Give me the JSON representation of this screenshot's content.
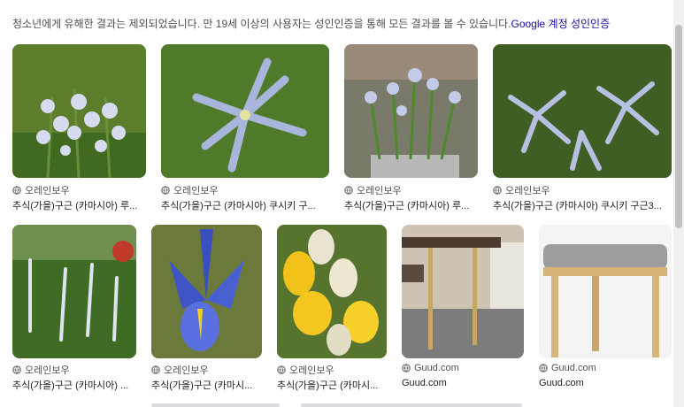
{
  "notice": {
    "text": "청소년에게 유해한 결과는 제외되었습니다. 만 19세 이상의 사용자는 성인인증을 통해 모든 결과를 볼 수 있습니다.",
    "link": "Google 계정 성인인증"
  },
  "results": [
    {
      "source": "오레인보우",
      "title": "추식(가을)구근 (카마시아) 루..."
    },
    {
      "source": "오레인보우",
      "title": "추식(가을)구근 (카마시아) 쿠시키 구..."
    },
    {
      "source": "오레인보우",
      "title": "추식(가을)구근 (카마시아) 루..."
    },
    {
      "source": "오레인보우",
      "title": "추식(가을)구근 (카마시아) 쿠시키 구근3..."
    },
    {
      "source": "오레인보우",
      "title": "추식(가을)구근 (카마시아) ..."
    },
    {
      "source": "오레인보우",
      "title": "추식(가을)구근 (카마시..."
    },
    {
      "source": "오레인보우",
      "title": "추식(가을)구근 (카마시..."
    },
    {
      "source": "Guud.com",
      "title": "Guud.com"
    },
    {
      "source": "Guud.com",
      "title": "Guud.com"
    }
  ],
  "icons": {
    "source": "globe-icon"
  },
  "colors": {
    "link": "#1a0dab",
    "meta": "#4d5156"
  }
}
